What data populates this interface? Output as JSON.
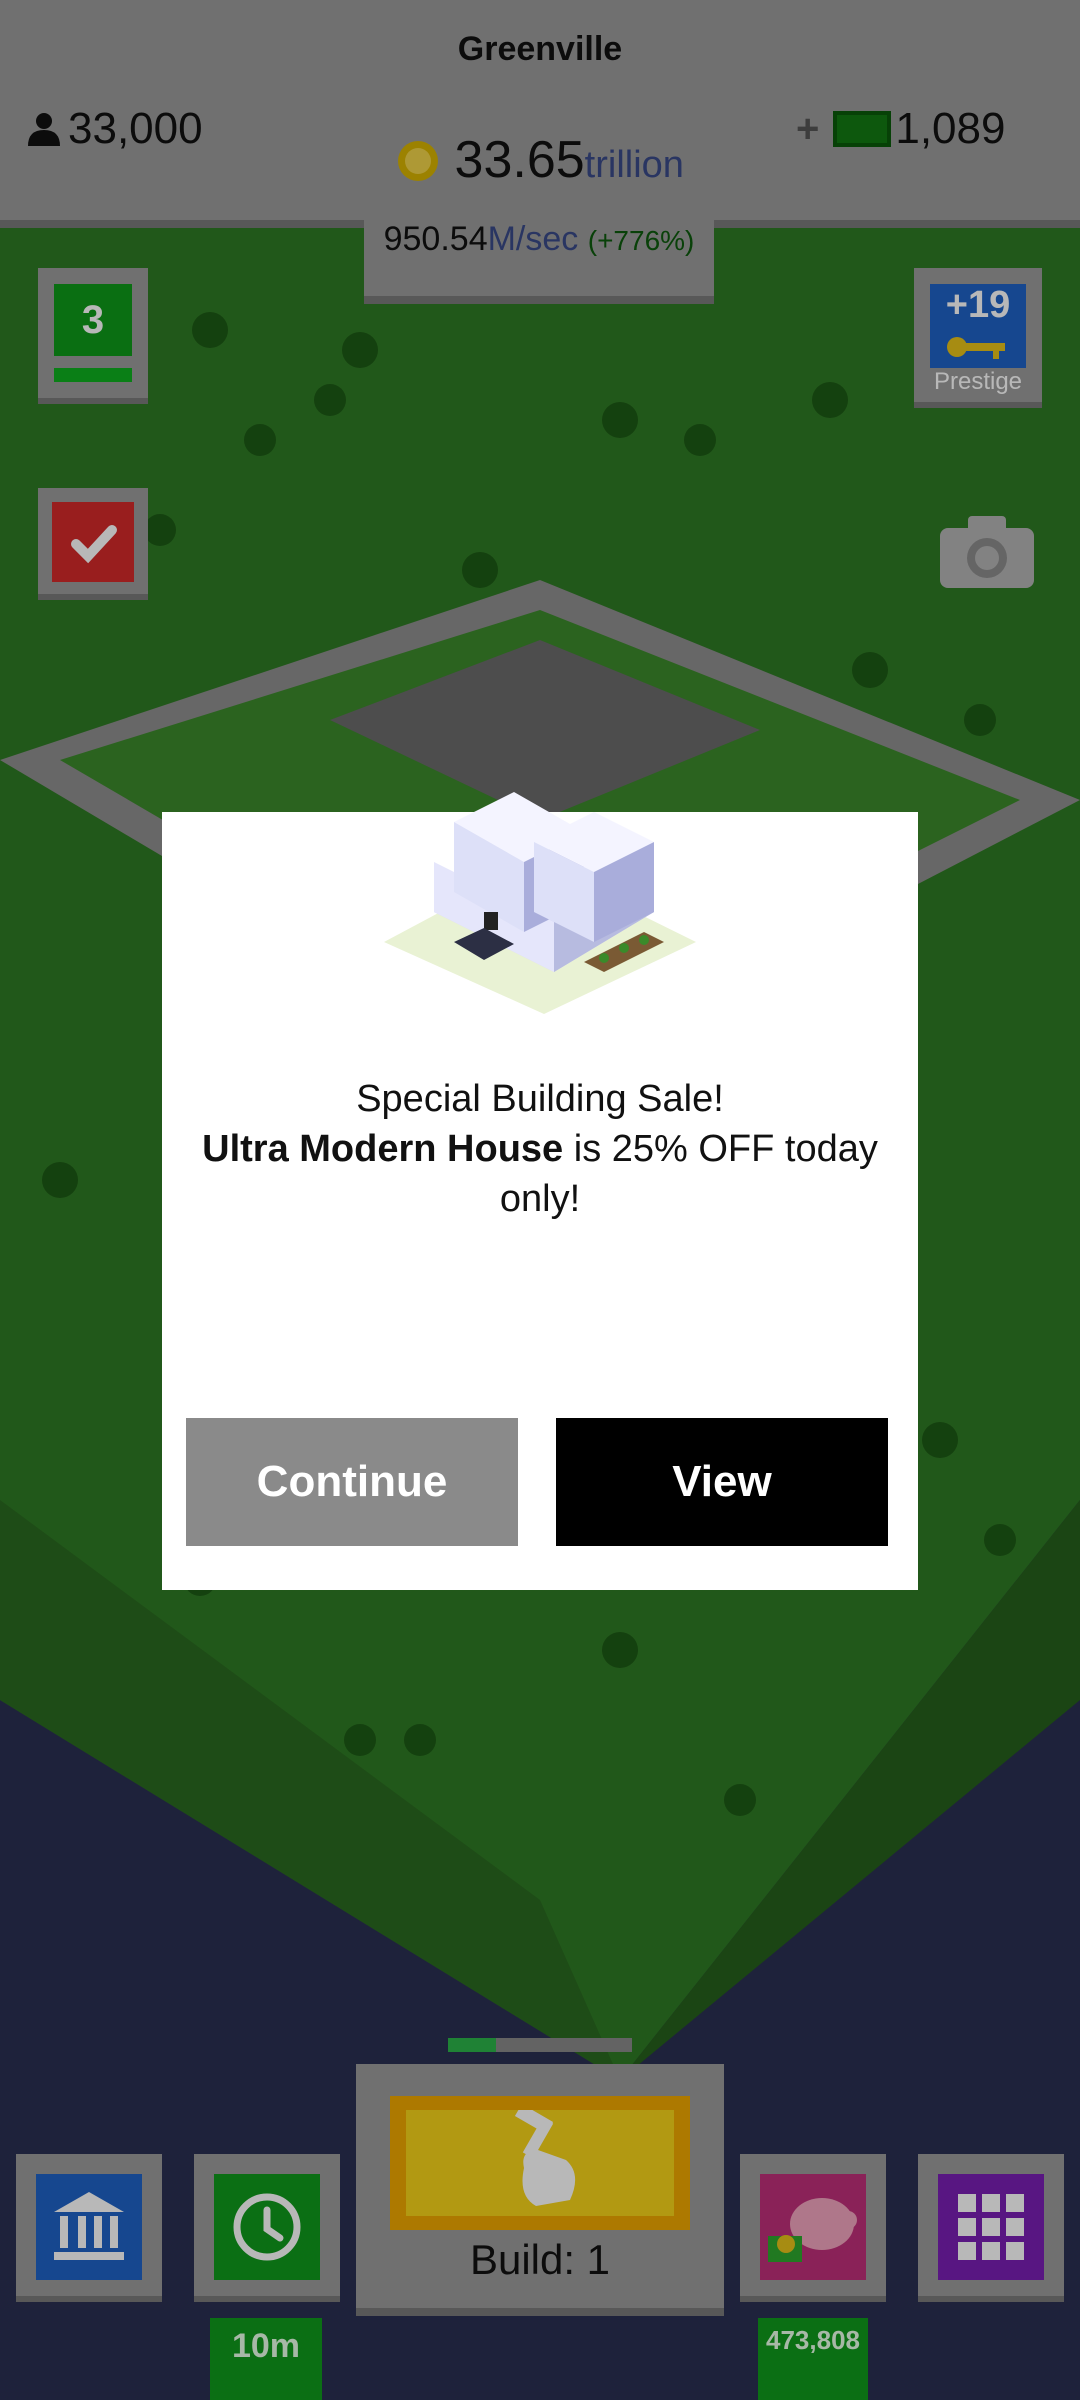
{
  "header": {
    "city_name": "Greenville",
    "population": "33,000",
    "coins": "33.65",
    "coins_unit": "trillion",
    "rate_value": "950.54",
    "rate_unit": "M/sec",
    "rate_bonus": "(+776%)",
    "plus_label": "+",
    "cash": "1,089"
  },
  "side": {
    "level": "3",
    "prestige_value": "+19",
    "prestige_label": "Prestige"
  },
  "dialog": {
    "title": "Special Building Sale!",
    "building_name": "Ultra Modern House",
    "offer_text": " is 25% OFF today only!",
    "continue_label": "Continue",
    "view_label": "View"
  },
  "bottom": {
    "build_label": "Build: 1",
    "timer_label": "10m",
    "bank_value": "473,808",
    "build_progress": 0.26
  },
  "colors": {
    "map_green": "#3f8a2e",
    "water": "#2a3052",
    "accent_green": "#109a1c",
    "accent_blue": "#1f63c7"
  }
}
